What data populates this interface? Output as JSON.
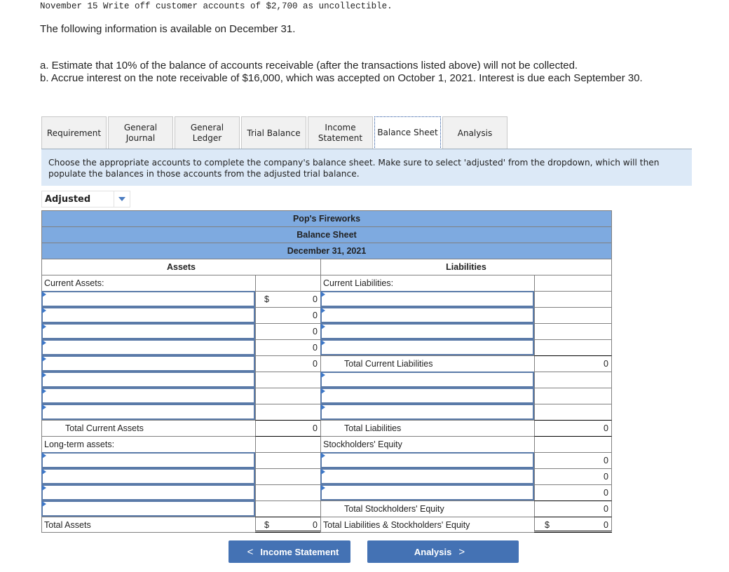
{
  "transaction_line": "November 15 Write off customer accounts of $2,700 as uncollectible.",
  "intro": "The following information is available on December 31.",
  "requirements": {
    "a": "a. Estimate that 10% of the balance of accounts receivable (after the transactions listed above) will not be collected.",
    "b": "b. Accrue interest on the note receivable of $16,000, which was accepted on October 1, 2021. Interest is due each September 30."
  },
  "tabs": [
    {
      "line1": "Requirement",
      "line2": ""
    },
    {
      "line1": "General",
      "line2": "Journal"
    },
    {
      "line1": "General",
      "line2": "Ledger"
    },
    {
      "line1": "Trial Balance",
      "line2": ""
    },
    {
      "line1": "Income",
      "line2": "Statement"
    },
    {
      "line1": "Balance Sheet",
      "line2": "",
      "active": true
    },
    {
      "line1": "Analysis",
      "line2": ""
    }
  ],
  "instructions": "Choose the appropriate accounts to complete the company's balance sheet. Make sure to select 'adjusted' from the dropdown, which will then populate the balances in those accounts from the adjusted trial balance.",
  "dropdown": {
    "selected": "Adjusted"
  },
  "sheet": {
    "company": "Pop's Fireworks",
    "title": "Balance Sheet",
    "date": "December 31, 2021",
    "assets_header": "Assets",
    "liabilities_header": "Liabilities",
    "currency": "$",
    "left": {
      "current_assets_label": "Current Assets:",
      "current_amounts": [
        "0",
        "0",
        "0",
        "0",
        "0"
      ],
      "total_current_assets_label": "Total Current Assets",
      "total_current_assets": "0",
      "long_term_label": "Long-term assets:",
      "total_assets_label": "Total Assets",
      "total_assets": "0"
    },
    "right": {
      "current_liabilities_label": "Current Liabilities:",
      "total_current_liabilities_label": "Total Current Liabilities",
      "total_current_liabilities": "0",
      "total_liabilities_label": "Total Liabilities",
      "total_liabilities": "0",
      "equity_label": "Stockholders' Equity",
      "equity_amounts": [
        "0",
        "0",
        "0"
      ],
      "total_equity_label": "Total Stockholders' Equity",
      "total_equity": "0",
      "total_liab_equity_label": "Total Liabilities & Stockholders' Equity",
      "total_liab_equity": "0"
    }
  },
  "nav": {
    "prev_label": "Income Statement",
    "next_label": "Analysis",
    "prev_icon": "<",
    "next_icon": ">"
  }
}
